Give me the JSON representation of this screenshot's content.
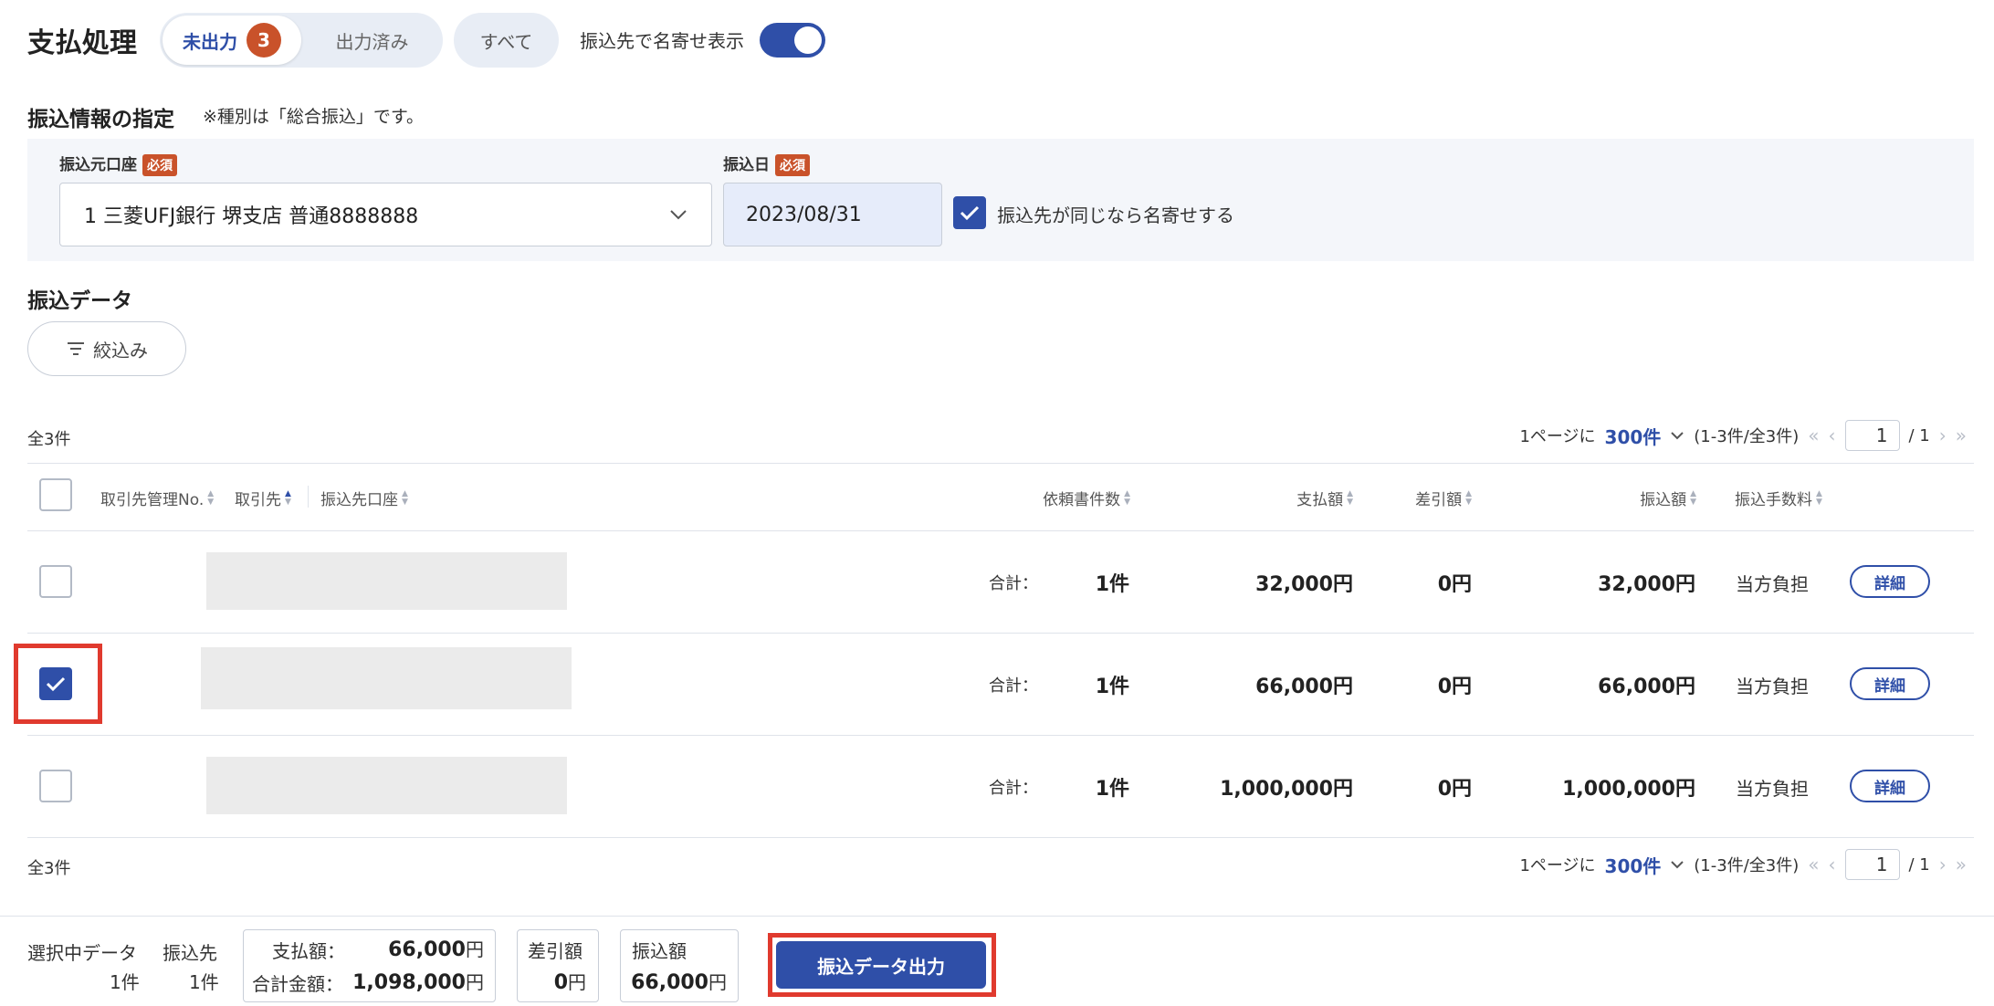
{
  "header": {
    "title": "支払処理",
    "tabs": [
      {
        "label": "未出力",
        "badge": "3"
      },
      {
        "label": "出力済み"
      },
      {
        "label": "すべて"
      }
    ],
    "toggle_label": "振込先で名寄せ表示",
    "toggle_on": true
  },
  "transfer_info": {
    "title": "振込情報の指定",
    "note": "※種別は「総合振込」です。",
    "account_label": "振込元口座",
    "required": "必須",
    "account_value": "1 三菱UFJ銀行 堺支店 普通8888888",
    "date_label": "振込日",
    "date_value": "2023/08/31",
    "merge_label": "振込先が同じなら名寄せする",
    "merge_checked": true
  },
  "data_section": {
    "title": "振込データ",
    "filter_label": "絞込み"
  },
  "pagination": {
    "total": "全3件",
    "per_page_prefix": "1ページに",
    "per_page": "300件",
    "range": "(1-3件/全3件)",
    "page": "1",
    "page_total": "/ 1"
  },
  "table": {
    "headers": {
      "mgmt_no": "取引先管理No.",
      "partner": "取引先",
      "account": "振込先口座",
      "count": "依頼書件数",
      "payment": "支払額",
      "deduction": "差引額",
      "transfer": "振込額",
      "fee": "振込手数料"
    },
    "rows": [
      {
        "sum_label": "合計：",
        "count": "1件",
        "payment": "32,000円",
        "deduction": "0円",
        "transfer": "32,000円",
        "fee": "当方負担",
        "detail": "詳細",
        "checked": false
      },
      {
        "sum_label": "合計：",
        "count": "1件",
        "payment": "66,000円",
        "deduction": "0円",
        "transfer": "66,000円",
        "fee": "当方負担",
        "detail": "詳細",
        "checked": true
      },
      {
        "sum_label": "合計：",
        "count": "1件",
        "payment": "1,000,000円",
        "deduction": "0円",
        "transfer": "1,000,000円",
        "fee": "当方負担",
        "detail": "詳細",
        "checked": false
      }
    ]
  },
  "footer": {
    "selected_label": "選択中データ",
    "selected_value": "1件",
    "payee_label": "振込先",
    "payee_value": "1件",
    "payment_label": "支払額：",
    "payment_value": "66,000",
    "total_label": "合計金額：",
    "total_value": "1,098,000",
    "yen": "円",
    "deduction_label": "差引額",
    "deduction_value": "0",
    "transfer_label": "振込額",
    "transfer_value": "66,000",
    "export_label": "振込データ出力"
  },
  "colors": {
    "accent": "#2f4fa8",
    "badge": "#c9522a",
    "highlight": "#e03a2e"
  }
}
